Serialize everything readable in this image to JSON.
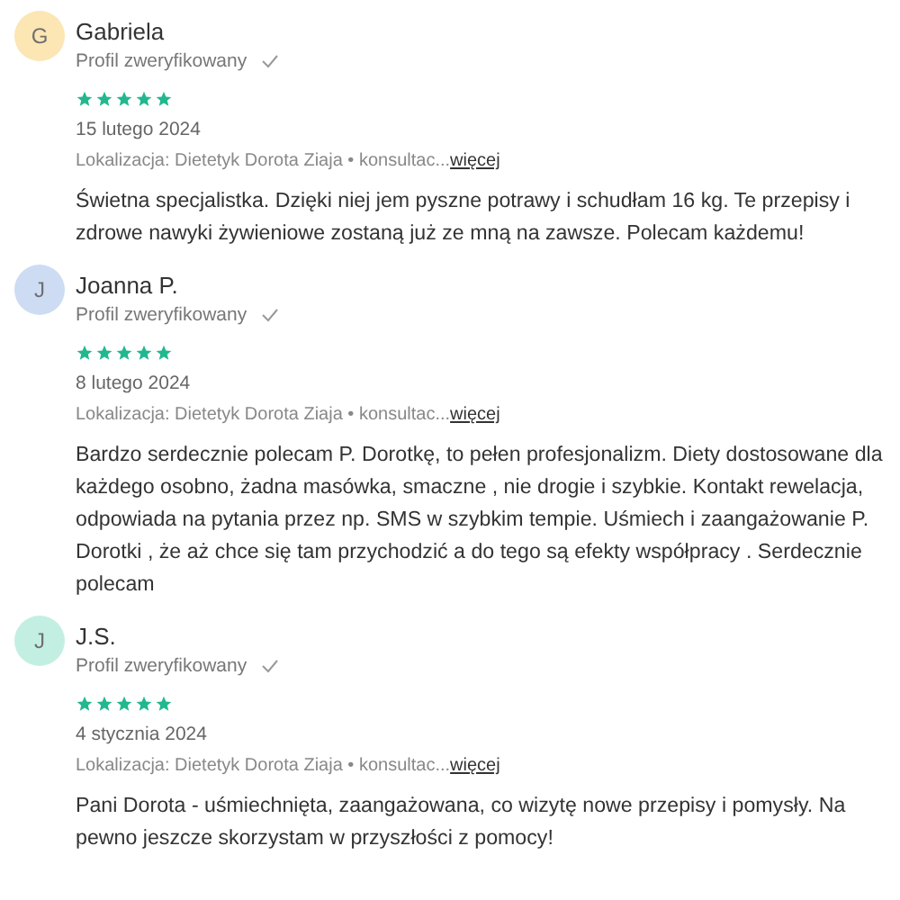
{
  "reviews": [
    {
      "initial": "G",
      "color": "#fbe6b4",
      "name": "Gabriela",
      "verified": true,
      "verified_label": "Profil zweryfikowany",
      "stars": 5,
      "date": "15 lutego 2024",
      "location": "Lokalizacja: Dietetyk Dorota Ziaja • konsultac...",
      "more_link": "więcej",
      "text": "Świetna specjalistka. Dzięki niej jem pyszne potrawy i schudłam 16 kg. Te przepisy i zdrowe nawyki żywieniowe zostaną już ze mną na zawsze. Polecam każdemu!"
    },
    {
      "initial": "J",
      "color": "#cddcf3",
      "name": "Joanna P.",
      "verified": true,
      "verified_label": "Profil zweryfikowany",
      "stars": 5,
      "date": "8 lutego 2024",
      "location": "Lokalizacja: Dietetyk Dorota Ziaja • konsultac...",
      "more_link": "więcej",
      "text": "Bardzo serdecznie polecam P. Dorotkę, to pełen profesjonalizm. Diety dostosowane dla każdego osobno, żadna masówka, smaczne , nie drogie i szybkie. Kontakt rewelacja, odpowiada na pytania przez np. SMS w szybkim tempie. Uśmiech i zaangażowanie P. Dorotki , że aż chce się tam przychodzić a do tego są efekty współpracy . Serdecznie polecam"
    },
    {
      "initial": "J",
      "color": "#c3efe2",
      "name": "J.S.",
      "verified": true,
      "verified_label": "Profil zweryfikowany",
      "stars": 5,
      "date": "4 stycznia 2024",
      "location": "Lokalizacja: Dietetyk Dorota Ziaja • konsultac...",
      "more_link": "więcej",
      "text": "Pani Dorota - uśmiechnięta, zaangażowana, co wizytę nowe przepisy i pomysły. Na pewno jeszcze skorzystam w przyszłości z pomocy!"
    }
  ]
}
